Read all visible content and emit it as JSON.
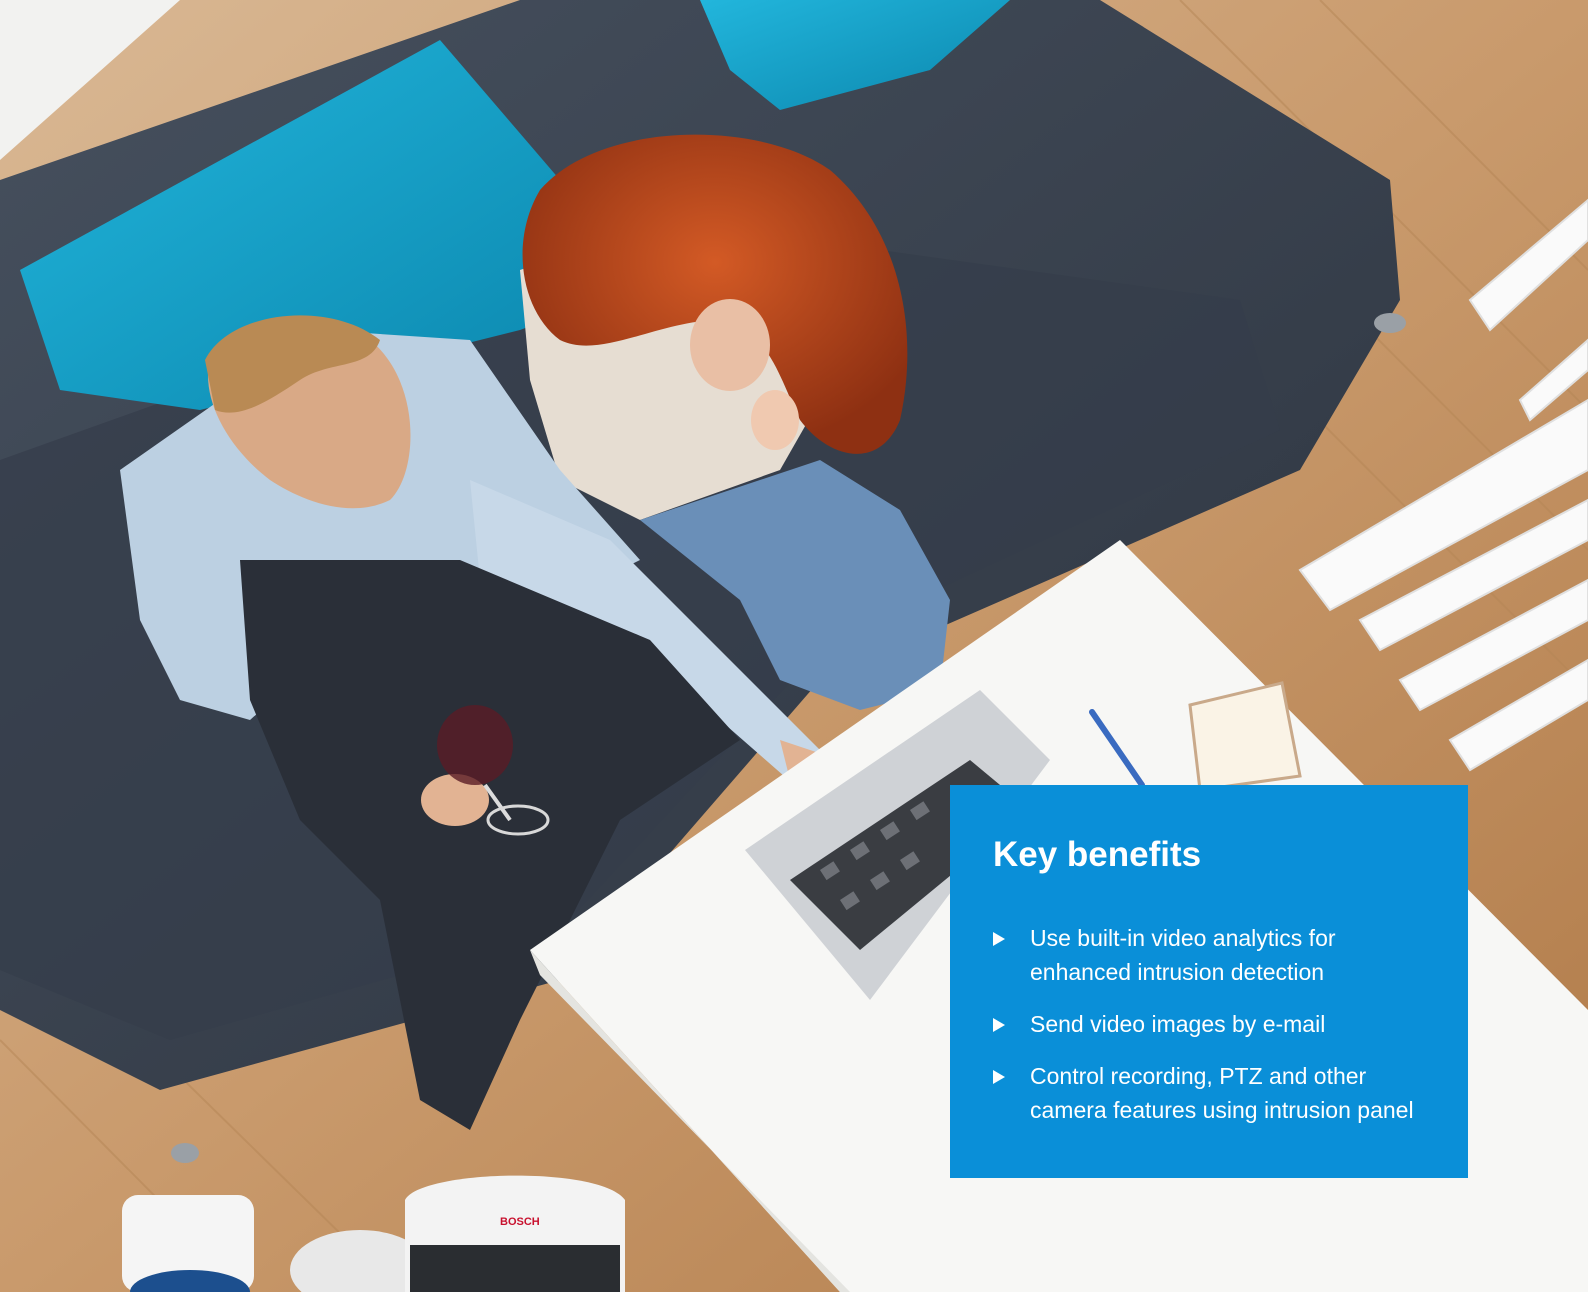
{
  "panel": {
    "background": "#0a8fd8",
    "title": "Key benefits",
    "items": [
      {
        "text": "Use built-in video analytics for enhanced intrusion detection"
      },
      {
        "text": "Send video images by e-mail"
      },
      {
        "text": "Control recording, PTZ and other camera features using intrusion panel"
      }
    ],
    "bullet_icon": "triangle-right-icon"
  },
  "photo": {
    "subject": "couple-on-sofa-with-laptop",
    "camera_brand": "BOSCH"
  },
  "colors": {
    "floor": "#c8a27a",
    "sofa": "#3a4250",
    "pillow": "#13a0c8",
    "table": "#f7f7f5",
    "hair": "#b8451c",
    "brand_blue": "#0a8fd8"
  }
}
